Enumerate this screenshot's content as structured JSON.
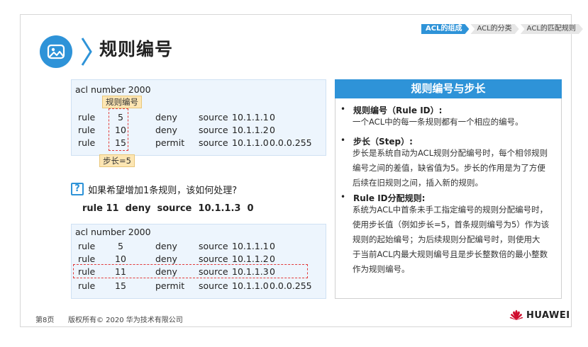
{
  "breadcrumb": [
    "ACL的组成",
    "ACL的分类",
    "ACL的匹配规则"
  ],
  "title": "规则编号",
  "box1": {
    "header": "acl number 2000",
    "tag_label": "规则编号",
    "rows": [
      [
        "rule",
        "5",
        "deny",
        "source",
        "10.1.1.1",
        "0"
      ],
      [
        "rule",
        "10",
        "deny",
        "source",
        "10.1.1.2",
        "0"
      ],
      [
        "rule",
        "15",
        "permit",
        "source",
        "10.1.1.0",
        "0.0.0.255"
      ]
    ],
    "step_label": "步长=5"
  },
  "question": "如果希望增加1条规则，该如何处理?",
  "question_icon": "?",
  "answer": "rule 11  deny  source  10.1.1.3  0",
  "box2": {
    "header": "acl number 2000",
    "rows": [
      [
        "rule",
        "5",
        "deny",
        "source",
        "10.1.1.1",
        "0"
      ],
      [
        "rule",
        "10",
        "deny",
        "source",
        "10.1.1.2",
        "0"
      ],
      [
        "rule",
        "11",
        "deny",
        "source",
        "10.1.1.3",
        "0"
      ],
      [
        "rule",
        "15",
        "permit",
        "source",
        "10.1.1.0",
        "0.0.0.255"
      ]
    ]
  },
  "panel": {
    "title": "规则编号与步长",
    "sections": [
      {
        "title": "规则编号（Rule ID）:",
        "lines": [
          "一个ACL中的每一条规则都有一个相应的编号。"
        ]
      },
      {
        "title": "步长（Step）:",
        "lines": [
          "步长是系统自动为ACL规则分配编号时，每个相邻规则",
          "编号之间的差值，缺省值为5。步长的作用是为了方便",
          "后续在旧规则之间，插入新的规则。"
        ]
      },
      {
        "title": "Rule ID分配规则:",
        "lines": [
          "系统为ACL中首条未手工指定编号的规则分配编号时，",
          "使用步长值（例如步长=5，首条规则编号为5）作为该",
          "规则的起始编号；为后续规则分配编号时，则使用大",
          "于当前ACL内最大规则编号且是步长整数倍的最小整数",
          "作为规则编号。"
        ]
      }
    ]
  },
  "footer": {
    "page": "第8页",
    "copyright": "版权所有© 2020 华为技术有限公司",
    "brand": "HUAWEI"
  },
  "colors": {
    "accent": "#2e93d8",
    "highlight_dash": "#e23c3c",
    "tag_bg": "#fde6b3",
    "code_bg": "#edf5fd",
    "brand_red": "#cf0a2c"
  }
}
